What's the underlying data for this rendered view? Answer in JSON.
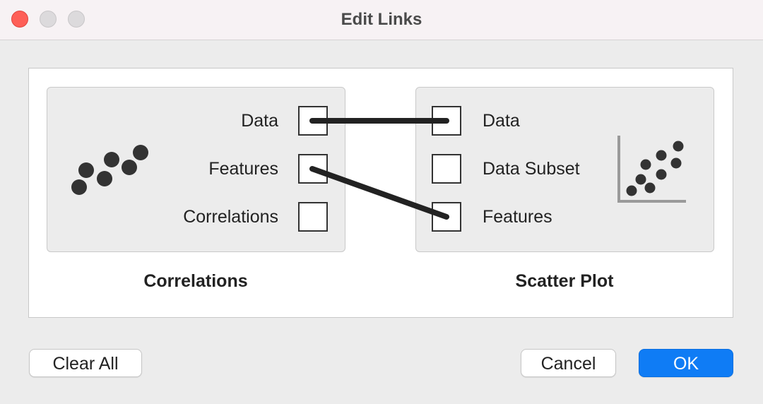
{
  "window": {
    "title": "Edit Links",
    "controls": {
      "close": "close-button",
      "minimize": "minimize-button",
      "maximize": "maximize-button"
    }
  },
  "source": {
    "name": "Correlations",
    "icon": "correlations-dots-icon",
    "ports": [
      {
        "label": "Data",
        "linked": true
      },
      {
        "label": "Features",
        "linked": true
      },
      {
        "label": "Correlations",
        "linked": false
      }
    ]
  },
  "target": {
    "name": "Scatter Plot",
    "icon": "scatter-plot-icon",
    "ports": [
      {
        "label": "Data",
        "linked": true
      },
      {
        "label": "Data Subset",
        "linked": false
      },
      {
        "label": "Features",
        "linked": true
      }
    ]
  },
  "links": [
    {
      "from": "Data",
      "to": "Data"
    },
    {
      "from": "Features",
      "to": "Features"
    }
  ],
  "buttons": {
    "clear_all": "Clear All",
    "cancel": "Cancel",
    "ok": "OK"
  },
  "colors": {
    "accent": "#0f7cf5",
    "close": "#fe5f57",
    "link_line": "#222222"
  }
}
